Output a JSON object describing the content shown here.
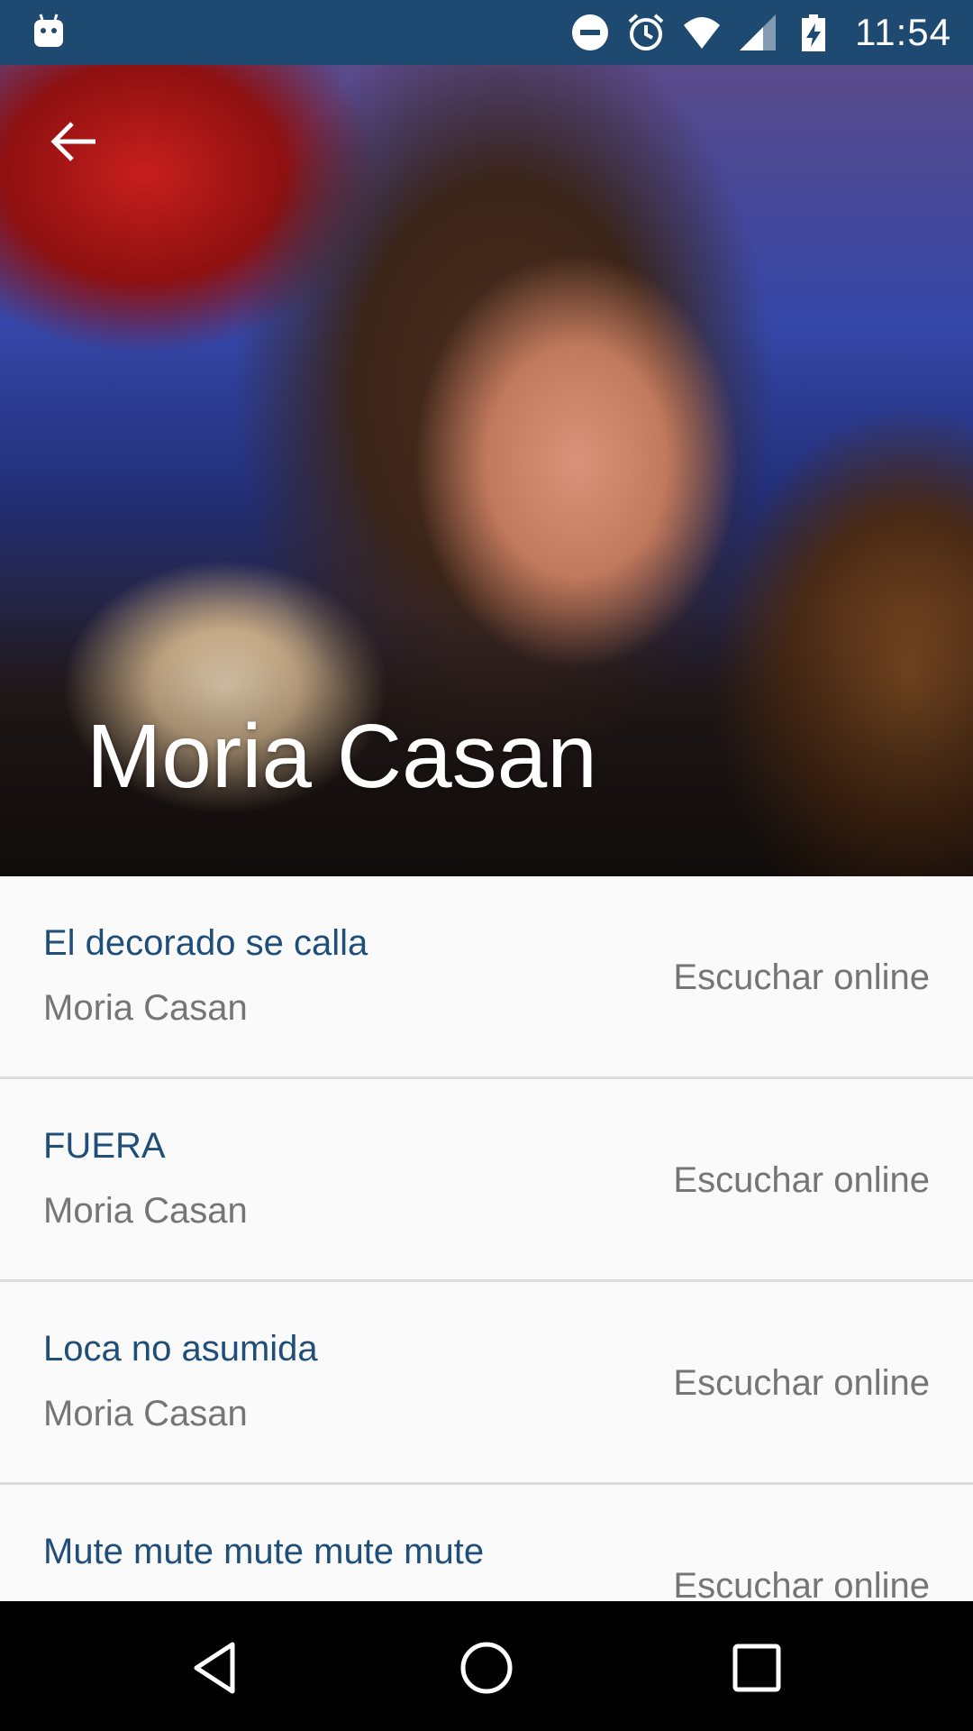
{
  "status_bar": {
    "time": "11:54",
    "icons": [
      "android-notification-icon",
      "do-not-disturb-icon",
      "alarm-icon",
      "wifi-icon",
      "signal-icon",
      "battery-charging-icon"
    ]
  },
  "hero": {
    "title": "Moria Casan",
    "back_icon": "arrow-back-icon"
  },
  "tracks": [
    {
      "title": "El decorado se calla",
      "artist": "Moria Casan",
      "action": "Escuchar online"
    },
    {
      "title": "FUERA",
      "artist": "Moria Casan",
      "action": "Escuchar online"
    },
    {
      "title": "Loca no asumida",
      "artist": "Moria Casan",
      "action": "Escuchar online"
    },
    {
      "title": "Mute mute mute mute mute",
      "artist": "",
      "action": "Escuchar online"
    }
  ],
  "nav_bar": {
    "buttons": [
      "back-triangle-icon",
      "home-circle-icon",
      "recents-square-icon"
    ]
  },
  "colors": {
    "status_bar": "#1e4a72",
    "song_title": "#1f4e79",
    "secondary_text": "#757575",
    "divider": "#dcdcdc",
    "list_background": "#fafafa",
    "nav_bar": "#000000"
  }
}
